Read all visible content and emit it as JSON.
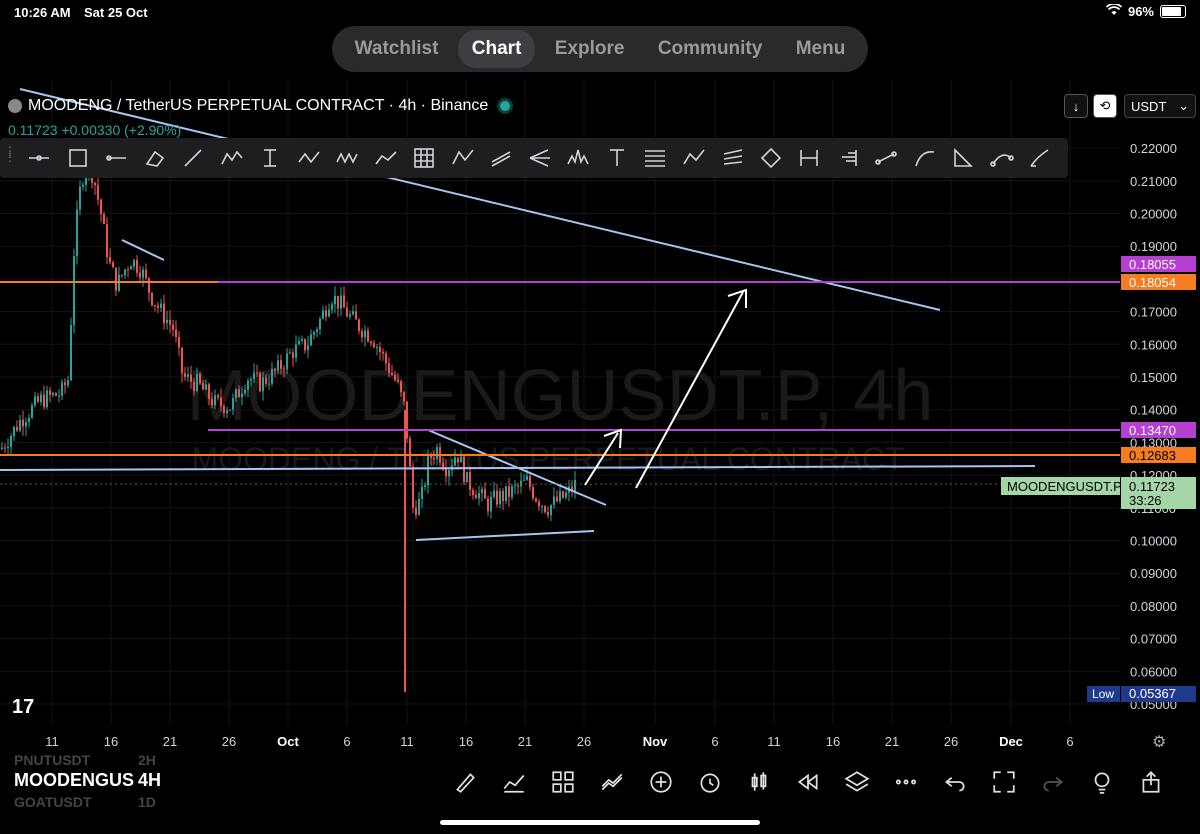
{
  "status": {
    "time": "10:26 AM",
    "date": "Sat 25 Oct",
    "battery": "96%"
  },
  "nav": {
    "tabs": [
      "Watchlist",
      "Chart",
      "Explore",
      "Community",
      "Menu"
    ],
    "active": "Chart"
  },
  "header": {
    "title": "MOODENG / TetherUS PERPETUAL CONTRACT · 4h · Binance",
    "price_change": "0.11723 +0.00330 (+2.90%)"
  },
  "toolbar": {
    "tools": [
      "horizontal-line-icon",
      "rectangle-icon",
      "ray-icon",
      "eraser-icon",
      "trendline-icon",
      "elliott-wave-icon",
      "fixed-range-volume-icon",
      "wxy-pattern-icon",
      "wxyxz-pattern-icon",
      "path-icon",
      "gann-box-icon",
      "abcd-pattern-icon",
      "parallel-channel-icon",
      "pitchfork-icon",
      "head-shoulders-icon",
      "text-icon",
      "fib-retracement-icon",
      "ae-pattern-icon",
      "fib-channel-icon",
      "polyline-icon",
      "date-price-range-icon",
      "volume-profile-icon",
      "info-line-icon",
      "curve-icon",
      "triangle-icon",
      "arc-icon",
      "brush-icon"
    ]
  },
  "controls": {
    "currency": "USDT"
  },
  "watermark": {
    "line1": "MOODENGUSDT.P, 4h",
    "line2": "MOODENG / TetherUS PERPETUAL CONTRACT"
  },
  "axis": {
    "price_ticks": [
      "0.22000",
      "0.21000",
      "0.20000",
      "0.19000",
      "0.18000",
      "0.17000",
      "0.16000",
      "0.15000",
      "0.14000",
      "0.13000",
      "0.12000",
      "0.11000",
      "0.10000",
      "0.09000",
      "0.08000",
      "0.07000",
      "0.06000",
      "0.05000"
    ],
    "time_ticks": [
      "11",
      "16",
      "21",
      "26",
      "Oct",
      "6",
      "11",
      "16",
      "21",
      "26",
      "Nov",
      "6",
      "11",
      "16",
      "21",
      "26",
      "Dec",
      "6"
    ]
  },
  "price_labels": {
    "purple_top": "0.18055",
    "orange_top": "0.18054",
    "purple_mid": "0.13470",
    "orange_mid": "0.12683",
    "current_symbol": "MOODENGUSDT.P",
    "current_price": "0.11723",
    "countdown": "33:26",
    "low_label": "Low",
    "low_value": "0.05367"
  },
  "colors": {
    "up": "#26a69a",
    "down": "#ef5350",
    "trend": "#a7c4f2",
    "purple": "#b43fd1",
    "orange": "#f57c20",
    "current": "#a5d6a7",
    "low": "#1e3a8a"
  },
  "bottom": {
    "ghost_top": "PNUTUSDT",
    "ghost_top_tf": "2H",
    "symbol": "MOODENGUS",
    "timeframe": "4H",
    "ghost_bottom": "GOATUSDT",
    "ghost_bottom_tf": "1D"
  },
  "bottom_tools": [
    "draw-icon",
    "indicators-icon",
    "layout-icon",
    "compare-icon",
    "add-icon",
    "alert-icon",
    "candle-type-icon",
    "replay-icon",
    "layers-icon",
    "more-icon",
    "undo-icon",
    "fullscreen-icon",
    "redo-icon",
    "ideas-icon",
    "share-icon"
  ]
}
